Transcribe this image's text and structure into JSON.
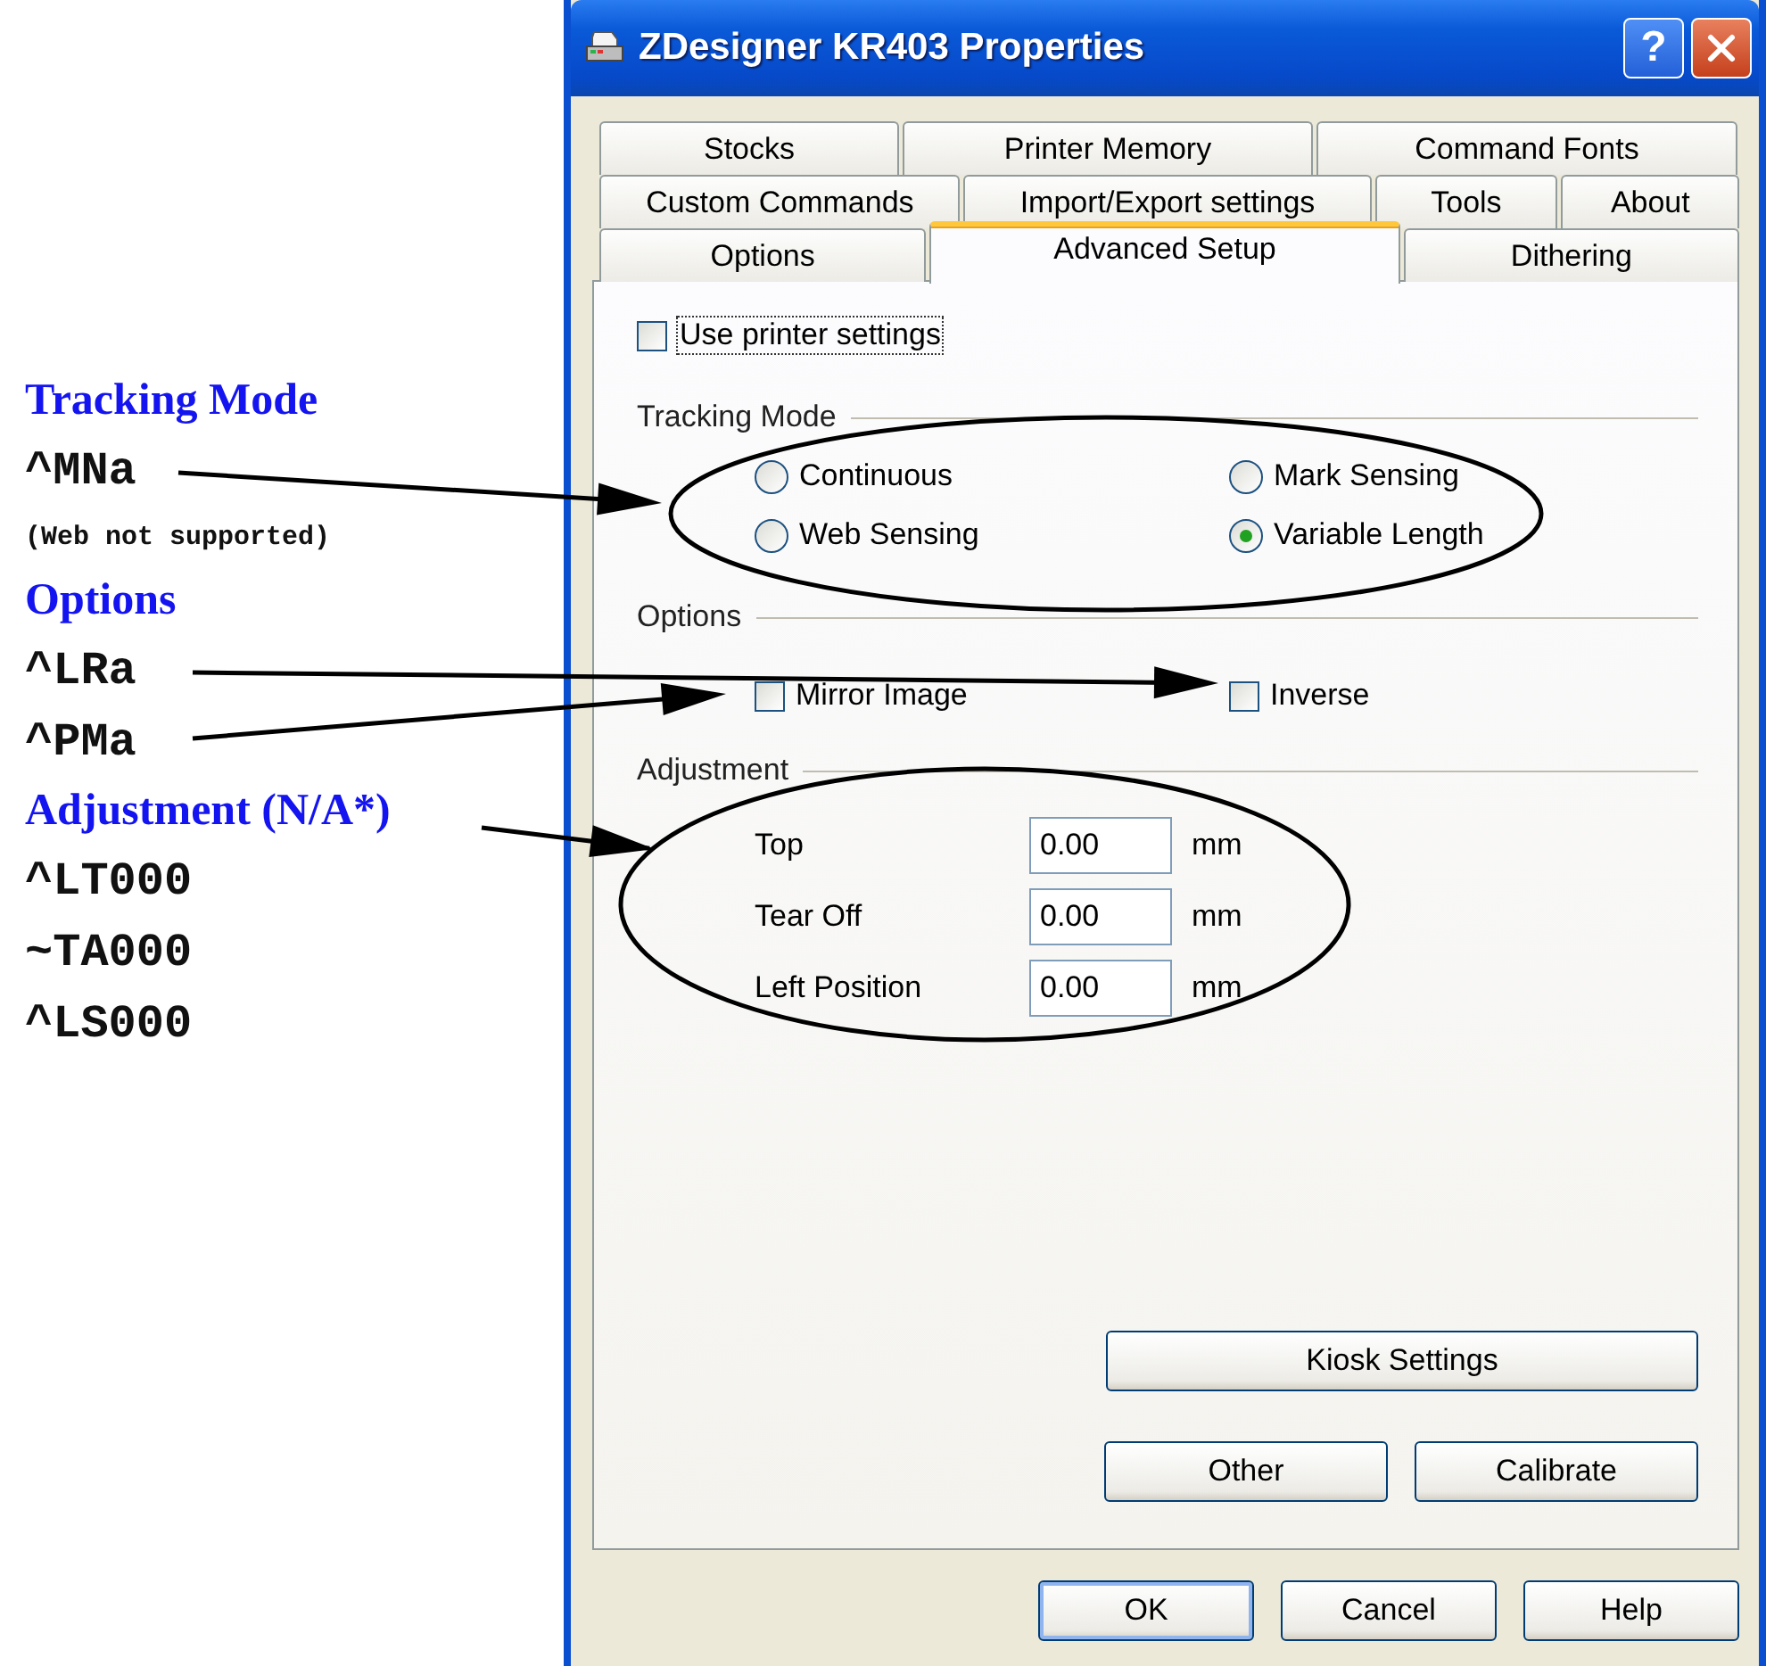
{
  "annotations": [
    {
      "kind": "heading",
      "text": "Tracking Mode"
    },
    {
      "kind": "code",
      "text": "^MNa"
    },
    {
      "kind": "note",
      "text": "(Web not supported)"
    },
    {
      "kind": "heading",
      "text": "Options"
    },
    {
      "kind": "code",
      "text": "^LRa"
    },
    {
      "kind": "code",
      "text": "^PMa"
    },
    {
      "kind": "heading",
      "text": "Adjustment (N/A*)"
    },
    {
      "kind": "code",
      "text": "^LT000"
    },
    {
      "kind": "code",
      "text": "~TA000"
    },
    {
      "kind": "code",
      "text": "^LS000"
    }
  ],
  "window": {
    "title": "ZDesigner KR403 Properties",
    "help_button": "?"
  },
  "tab_rows": [
    [
      {
        "label": "Stocks",
        "selected": false
      },
      {
        "label": "Printer Memory",
        "selected": false
      },
      {
        "label": "Command Fonts",
        "selected": false
      }
    ],
    [
      {
        "label": "Custom Commands",
        "selected": false
      },
      {
        "label": "Import/Export settings",
        "selected": false
      },
      {
        "label": "Tools",
        "selected": false
      },
      {
        "label": "About",
        "selected": false
      }
    ],
    [
      {
        "label": "Options",
        "selected": false
      },
      {
        "label": "Advanced Setup",
        "selected": true
      },
      {
        "label": "Dithering",
        "selected": false
      }
    ]
  ],
  "use_printer_settings": {
    "label": "Use printer settings",
    "checked": false
  },
  "tracking_mode": {
    "title": "Tracking Mode",
    "options": [
      {
        "label": "Continuous",
        "selected": false
      },
      {
        "label": "Mark Sensing",
        "selected": false
      },
      {
        "label": "Web Sensing",
        "selected": false
      },
      {
        "label": "Variable Length",
        "selected": true
      }
    ]
  },
  "options": {
    "title": "Options",
    "items": [
      {
        "label": "Mirror Image",
        "checked": false
      },
      {
        "label": "Inverse",
        "checked": false
      }
    ]
  },
  "adjustment": {
    "title": "Adjustment",
    "fields": [
      {
        "label": "Top",
        "value": "0.00",
        "unit": "mm"
      },
      {
        "label": "Tear Off",
        "value": "0.00",
        "unit": "mm"
      },
      {
        "label": "Left Position",
        "value": "0.00",
        "unit": "mm"
      }
    ]
  },
  "panel_buttons": [
    "Kiosk Settings",
    "Other",
    "Calibrate"
  ],
  "dialog_buttons": [
    {
      "label": "OK",
      "default": true
    },
    {
      "label": "Cancel",
      "default": false
    },
    {
      "label": "Help",
      "default": false
    }
  ]
}
